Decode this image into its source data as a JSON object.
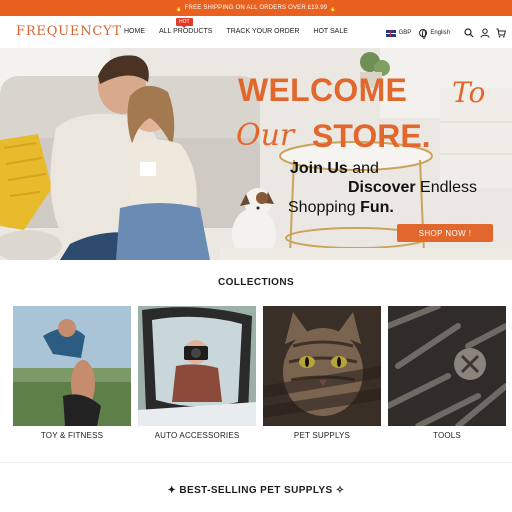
{
  "promo": {
    "text": "FREE SHIPPING ON ALL ORDERS OVER £19.99",
    "icon": "fire-icon",
    "bg_color": "#e8611f"
  },
  "header": {
    "logo": "FREQUENCYT",
    "nav": [
      {
        "label": "HOME"
      },
      {
        "label": "ALL PRODUCTS",
        "badge": "HOT"
      },
      {
        "label": "TRACK YOUR ORDER"
      },
      {
        "label": "HOT SALE"
      }
    ],
    "currency": "GBP",
    "language": "English",
    "icons": [
      "uk-flag-icon",
      "globe-icon",
      "search-icon",
      "account-icon",
      "cart-icon"
    ]
  },
  "hero": {
    "welcome": "WELCOME",
    "to": "To",
    "our": "Our",
    "store": "STORE.",
    "line1_bold": "Join Us",
    "line1_rest": " and",
    "line2_bold": "Discover",
    "line2_rest": " Endless",
    "line3_rest": "Shopping ",
    "line3_bold": "Fun.",
    "cta": "SHOP NOW !",
    "accent": "#e2672c"
  },
  "collections": {
    "title": "COLLECTIONS",
    "items": [
      {
        "label": "TOY & FITNESS"
      },
      {
        "label": "AUTO ACCESSORIES"
      },
      {
        "label": "PET SUPPLYS"
      },
      {
        "label": "TOOLS"
      }
    ]
  },
  "bestselling": {
    "title": "✦ BEST-SELLING PET SUPPLYS ✧"
  }
}
